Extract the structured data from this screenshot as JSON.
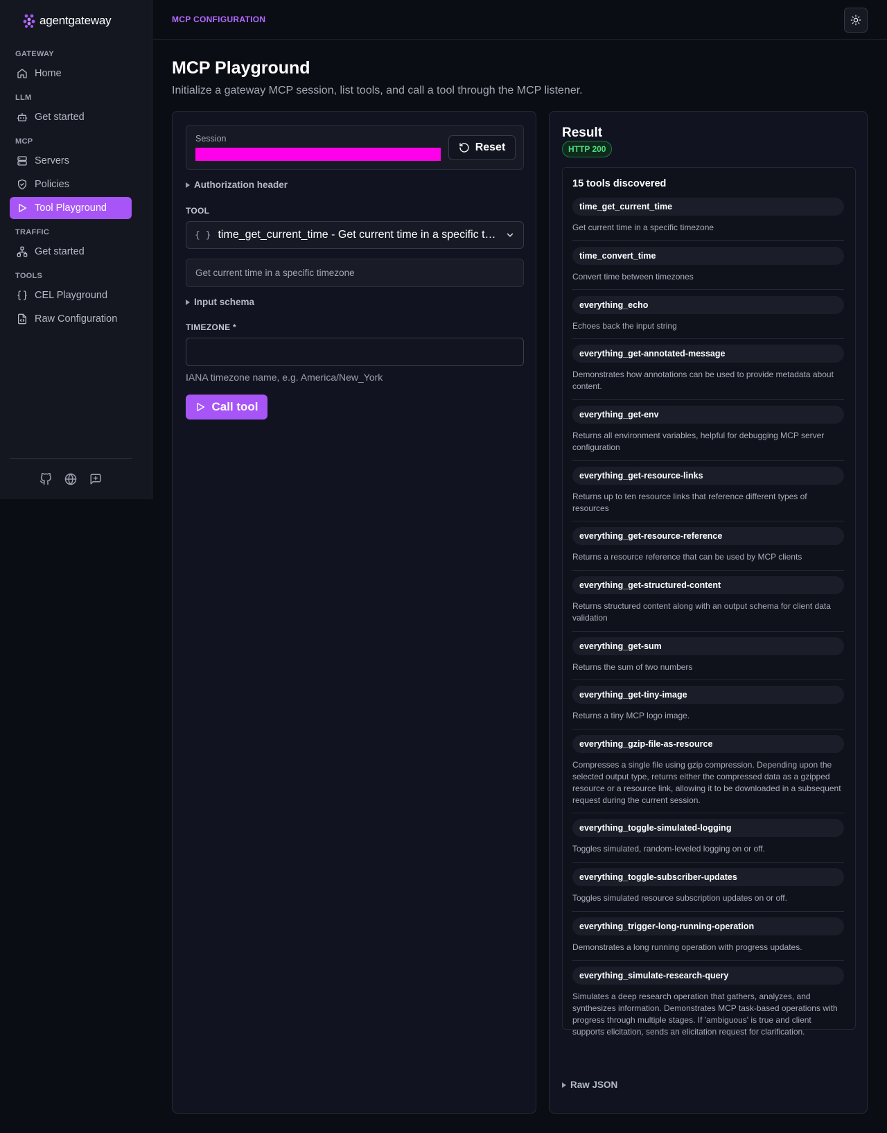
{
  "brand": {
    "name": "agentgateway"
  },
  "sidebar": {
    "sections": [
      {
        "title": "GATEWAY",
        "items": [
          {
            "label": "Home",
            "icon": "home-icon"
          }
        ]
      },
      {
        "title": "LLM",
        "items": [
          {
            "label": "Get started",
            "icon": "bot-icon"
          }
        ]
      },
      {
        "title": "MCP",
        "items": [
          {
            "label": "Servers",
            "icon": "server-icon"
          },
          {
            "label": "Policies",
            "icon": "shield-icon"
          },
          {
            "label": "Tool Playground",
            "icon": "play-icon",
            "active": true
          }
        ]
      },
      {
        "title": "TRAFFIC",
        "items": [
          {
            "label": "Get started",
            "icon": "network-icon"
          }
        ]
      },
      {
        "title": "TOOLS",
        "items": [
          {
            "label": "CEL Playground",
            "icon": "braces-icon"
          },
          {
            "label": "Raw Configuration",
            "icon": "file-code-icon"
          }
        ]
      }
    ],
    "footer_icons": [
      "github-icon",
      "globe-icon",
      "feedback-icon"
    ]
  },
  "header": {
    "breadcrumb": "MCP CONFIGURATION",
    "theme_icon": "sun-icon"
  },
  "page": {
    "title": "MCP Playground",
    "subtitle": "Initialize a gateway MCP session, list tools, and call a tool through the MCP listener."
  },
  "playground": {
    "session_label": "Session",
    "reset_label": "Reset",
    "auth_header_label": "Authorization header",
    "tool_label": "TOOL",
    "selected_tool": "time_get_current_time - Get current time in a specific timezone",
    "selected_tool_description": "Get current time in a specific timezone",
    "input_schema_label": "Input schema",
    "timezone_label": "TIMEZONE *",
    "timezone_value": "",
    "timezone_help": "IANA timezone name, e.g. America/New_York",
    "call_label": "Call tool"
  },
  "result": {
    "title": "Result",
    "status": "HTTP 200",
    "tools_count": "15 tools discovered",
    "tools": [
      {
        "name": "time_get_current_time",
        "desc": "Get current time in a specific timezone"
      },
      {
        "name": "time_convert_time",
        "desc": "Convert time between timezones"
      },
      {
        "name": "everything_echo",
        "desc": "Echoes back the input string"
      },
      {
        "name": "everything_get-annotated-message",
        "desc": "Demonstrates how annotations can be used to provide metadata about content."
      },
      {
        "name": "everything_get-env",
        "desc": "Returns all environment variables, helpful for debugging MCP server configuration"
      },
      {
        "name": "everything_get-resource-links",
        "desc": "Returns up to ten resource links that reference different types of resources"
      },
      {
        "name": "everything_get-resource-reference",
        "desc": "Returns a resource reference that can be used by MCP clients"
      },
      {
        "name": "everything_get-structured-content",
        "desc": "Returns structured content along with an output schema for client data validation"
      },
      {
        "name": "everything_get-sum",
        "desc": "Returns the sum of two numbers"
      },
      {
        "name": "everything_get-tiny-image",
        "desc": "Returns a tiny MCP logo image."
      },
      {
        "name": "everything_gzip-file-as-resource",
        "desc": "Compresses a single file using gzip compression. Depending upon the selected output type, returns either the compressed data as a gzipped resource or a resource link, allowing it to be downloaded in a subsequent request during the current session."
      },
      {
        "name": "everything_toggle-simulated-logging",
        "desc": "Toggles simulated, random-leveled logging on or off."
      },
      {
        "name": "everything_toggle-subscriber-updates",
        "desc": "Toggles simulated resource subscription updates on or off."
      },
      {
        "name": "everything_trigger-long-running-operation",
        "desc": "Demonstrates a long running operation with progress updates."
      },
      {
        "name": "everything_simulate-research-query",
        "desc": "Simulates a deep research operation that gathers, analyzes, and synthesizes information. Demonstrates MCP task-based operations with progress through multiple stages. If 'ambiguous' is true and client supports elicitation, sends an elicitation request for clarification."
      }
    ],
    "raw_json_label": "Raw JSON"
  },
  "colors": {
    "accent": "#a855f7",
    "session_mask": "#ff00ea",
    "success": "#4ade80"
  }
}
